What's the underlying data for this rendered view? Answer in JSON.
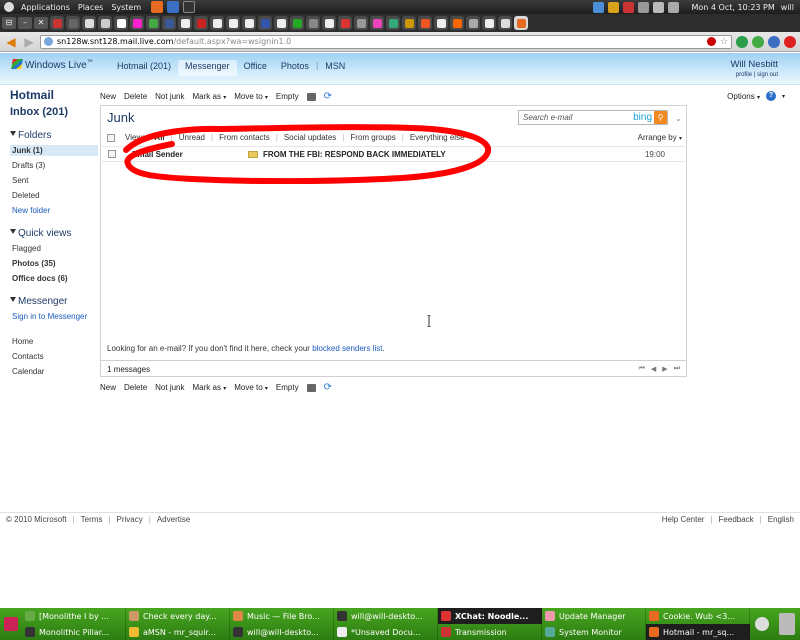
{
  "desktop": {
    "menus": [
      "Applications",
      "Places",
      "System"
    ],
    "clock": "Mon 4 Oct, 10:23 PM",
    "user": "will"
  },
  "browser": {
    "url_host": "sn128w.snt128.mail.live.com",
    "url_path": "/default.aspx?wa=wsignin1.0"
  },
  "header": {
    "brand": "Windows Live",
    "brand_tm": "™",
    "nav": [
      "Hotmail (201)",
      "Messenger",
      "Office",
      "Photos",
      "|",
      "MSN"
    ],
    "active_nav": "Messenger",
    "user_name": "Will Nesbitt",
    "profile_link": "profile",
    "signout_link": "sign out"
  },
  "sidebar": {
    "title": "Hotmail",
    "inbox": "Inbox (201)",
    "folders_heading": "Folders",
    "folders": [
      "Junk (1)",
      "Drafts (3)",
      "Sent",
      "Deleted"
    ],
    "new_folder": "New folder",
    "quick_heading": "Quick views",
    "quick": [
      "Flagged",
      "Photos (35)",
      "Office docs (6)"
    ],
    "messenger_heading": "Messenger",
    "messenger_link": "Sign in to Messenger",
    "bottom": [
      "Home",
      "Contacts",
      "Calendar"
    ]
  },
  "toolbar": {
    "new": "New",
    "delete": "Delete",
    "not_junk": "Not junk",
    "mark_as": "Mark as",
    "move_to": "Move to",
    "empty": "Empty",
    "options": "Options"
  },
  "main": {
    "title": "Junk",
    "search_placeholder": "Search e-mail",
    "search_brand": "bing",
    "filters": {
      "view": "View:",
      "all": "All",
      "unread": "Unread",
      "from_contacts": "From contacts",
      "social": "Social updates",
      "groups": "From groups",
      "everything": "Everything else"
    },
    "arrange_by": "Arrange by",
    "messages": [
      {
        "sender": "Email Sender",
        "subject": "FROM THE FBI: RESPOND BACK IMMEDIATELY",
        "time": "19:00"
      }
    ],
    "blocked_prefix": "Looking for an e-mail? If you don't find it here, check your ",
    "blocked_link": "blocked senders list",
    "blocked_suffix": ".",
    "count": "1 messages"
  },
  "footer": {
    "copyright": "© 2010 Microsoft",
    "left_links": [
      "Terms",
      "Privacy",
      "Advertise"
    ],
    "right_links": [
      "Help Center",
      "Feedback",
      "English"
    ]
  },
  "taskbar": {
    "row1": [
      "[Monolithe I by ...",
      "Check every day...",
      "Music — File Bro...",
      "will@will-deskto...",
      "XChat: Noodle...",
      "Update Manager",
      "Cookie. Wub <3..."
    ],
    "row2": [
      "Monolithic Pillar...",
      "aMSN - mr_squir...",
      "will@will-deskto...",
      "*Unsaved Docu...",
      "Transmission",
      "System Monitor",
      "Hotmail - mr_sq..."
    ]
  },
  "colors": {
    "annotation": "#ff0000",
    "link": "#1a5bbd",
    "brand_blue": "#1e3a66"
  }
}
